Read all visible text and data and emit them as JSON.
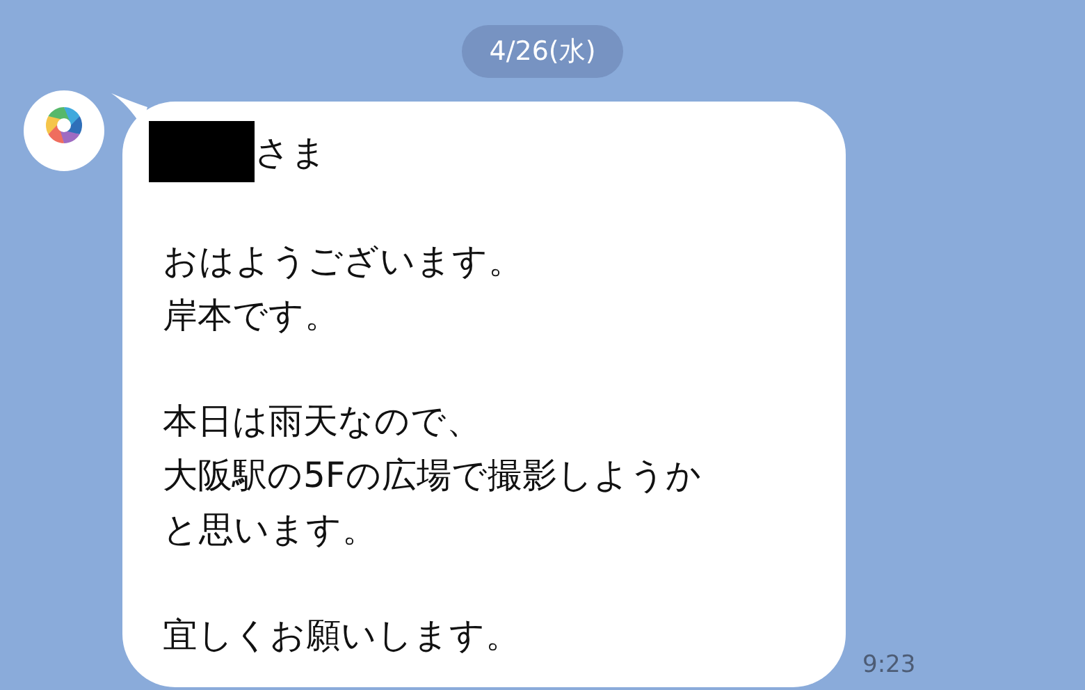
{
  "date_label": "4/26(水)",
  "message": {
    "redacted_name": true,
    "salutation": "さま",
    "paragraphs": [
      [
        "おはようございます。",
        "岸本です。"
      ],
      [
        "本日は雨天なので、",
        "大阪駅の5Fの広場で撮影しようか",
        "と思います。"
      ],
      [
        "宜しくお願いします。"
      ]
    ],
    "time": "9:23"
  }
}
